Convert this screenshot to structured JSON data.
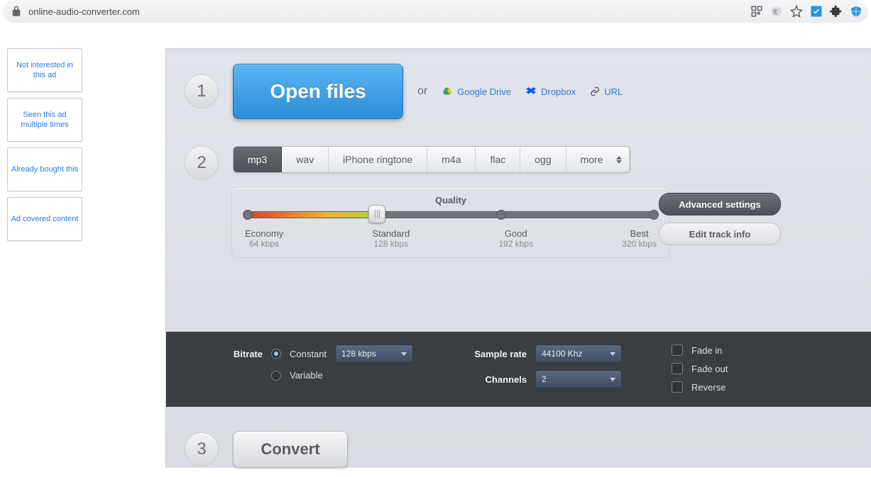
{
  "url": "online-audio-converter.com",
  "ad_feedback": [
    "Not interested in this ad",
    "Seen this ad multiple times",
    "Already bought this",
    "Ad covered content"
  ],
  "step1": {
    "open": "Open files",
    "or": "or",
    "gdrive": "Google Drive",
    "dropbox": "Dropbox",
    "url": "URL"
  },
  "formats": [
    "mp3",
    "wav",
    "iPhone ringtone",
    "m4a",
    "flac",
    "ogg",
    "more"
  ],
  "quality": {
    "title": "Quality",
    "stops": [
      {
        "label": "Economy",
        "sub": "64 kbps"
      },
      {
        "label": "Standard",
        "sub": "128 kbps"
      },
      {
        "label": "Good",
        "sub": "192 kbps"
      },
      {
        "label": "Best",
        "sub": "320 kbps"
      }
    ]
  },
  "side": {
    "adv": "Advanced settings",
    "edit": "Edit track info"
  },
  "advanced": {
    "bitrate_label": "Bitrate",
    "bitrate_constant": "Constant",
    "bitrate_variable": "Variable",
    "bitrate_value": "128 kbps",
    "samplerate_label": "Sample rate",
    "samplerate_value": "44100 Khz",
    "channels_label": "Channels",
    "channels_value": "2",
    "fadein": "Fade in",
    "fadeout": "Fade out",
    "reverse": "Reverse"
  },
  "convert": "Convert"
}
